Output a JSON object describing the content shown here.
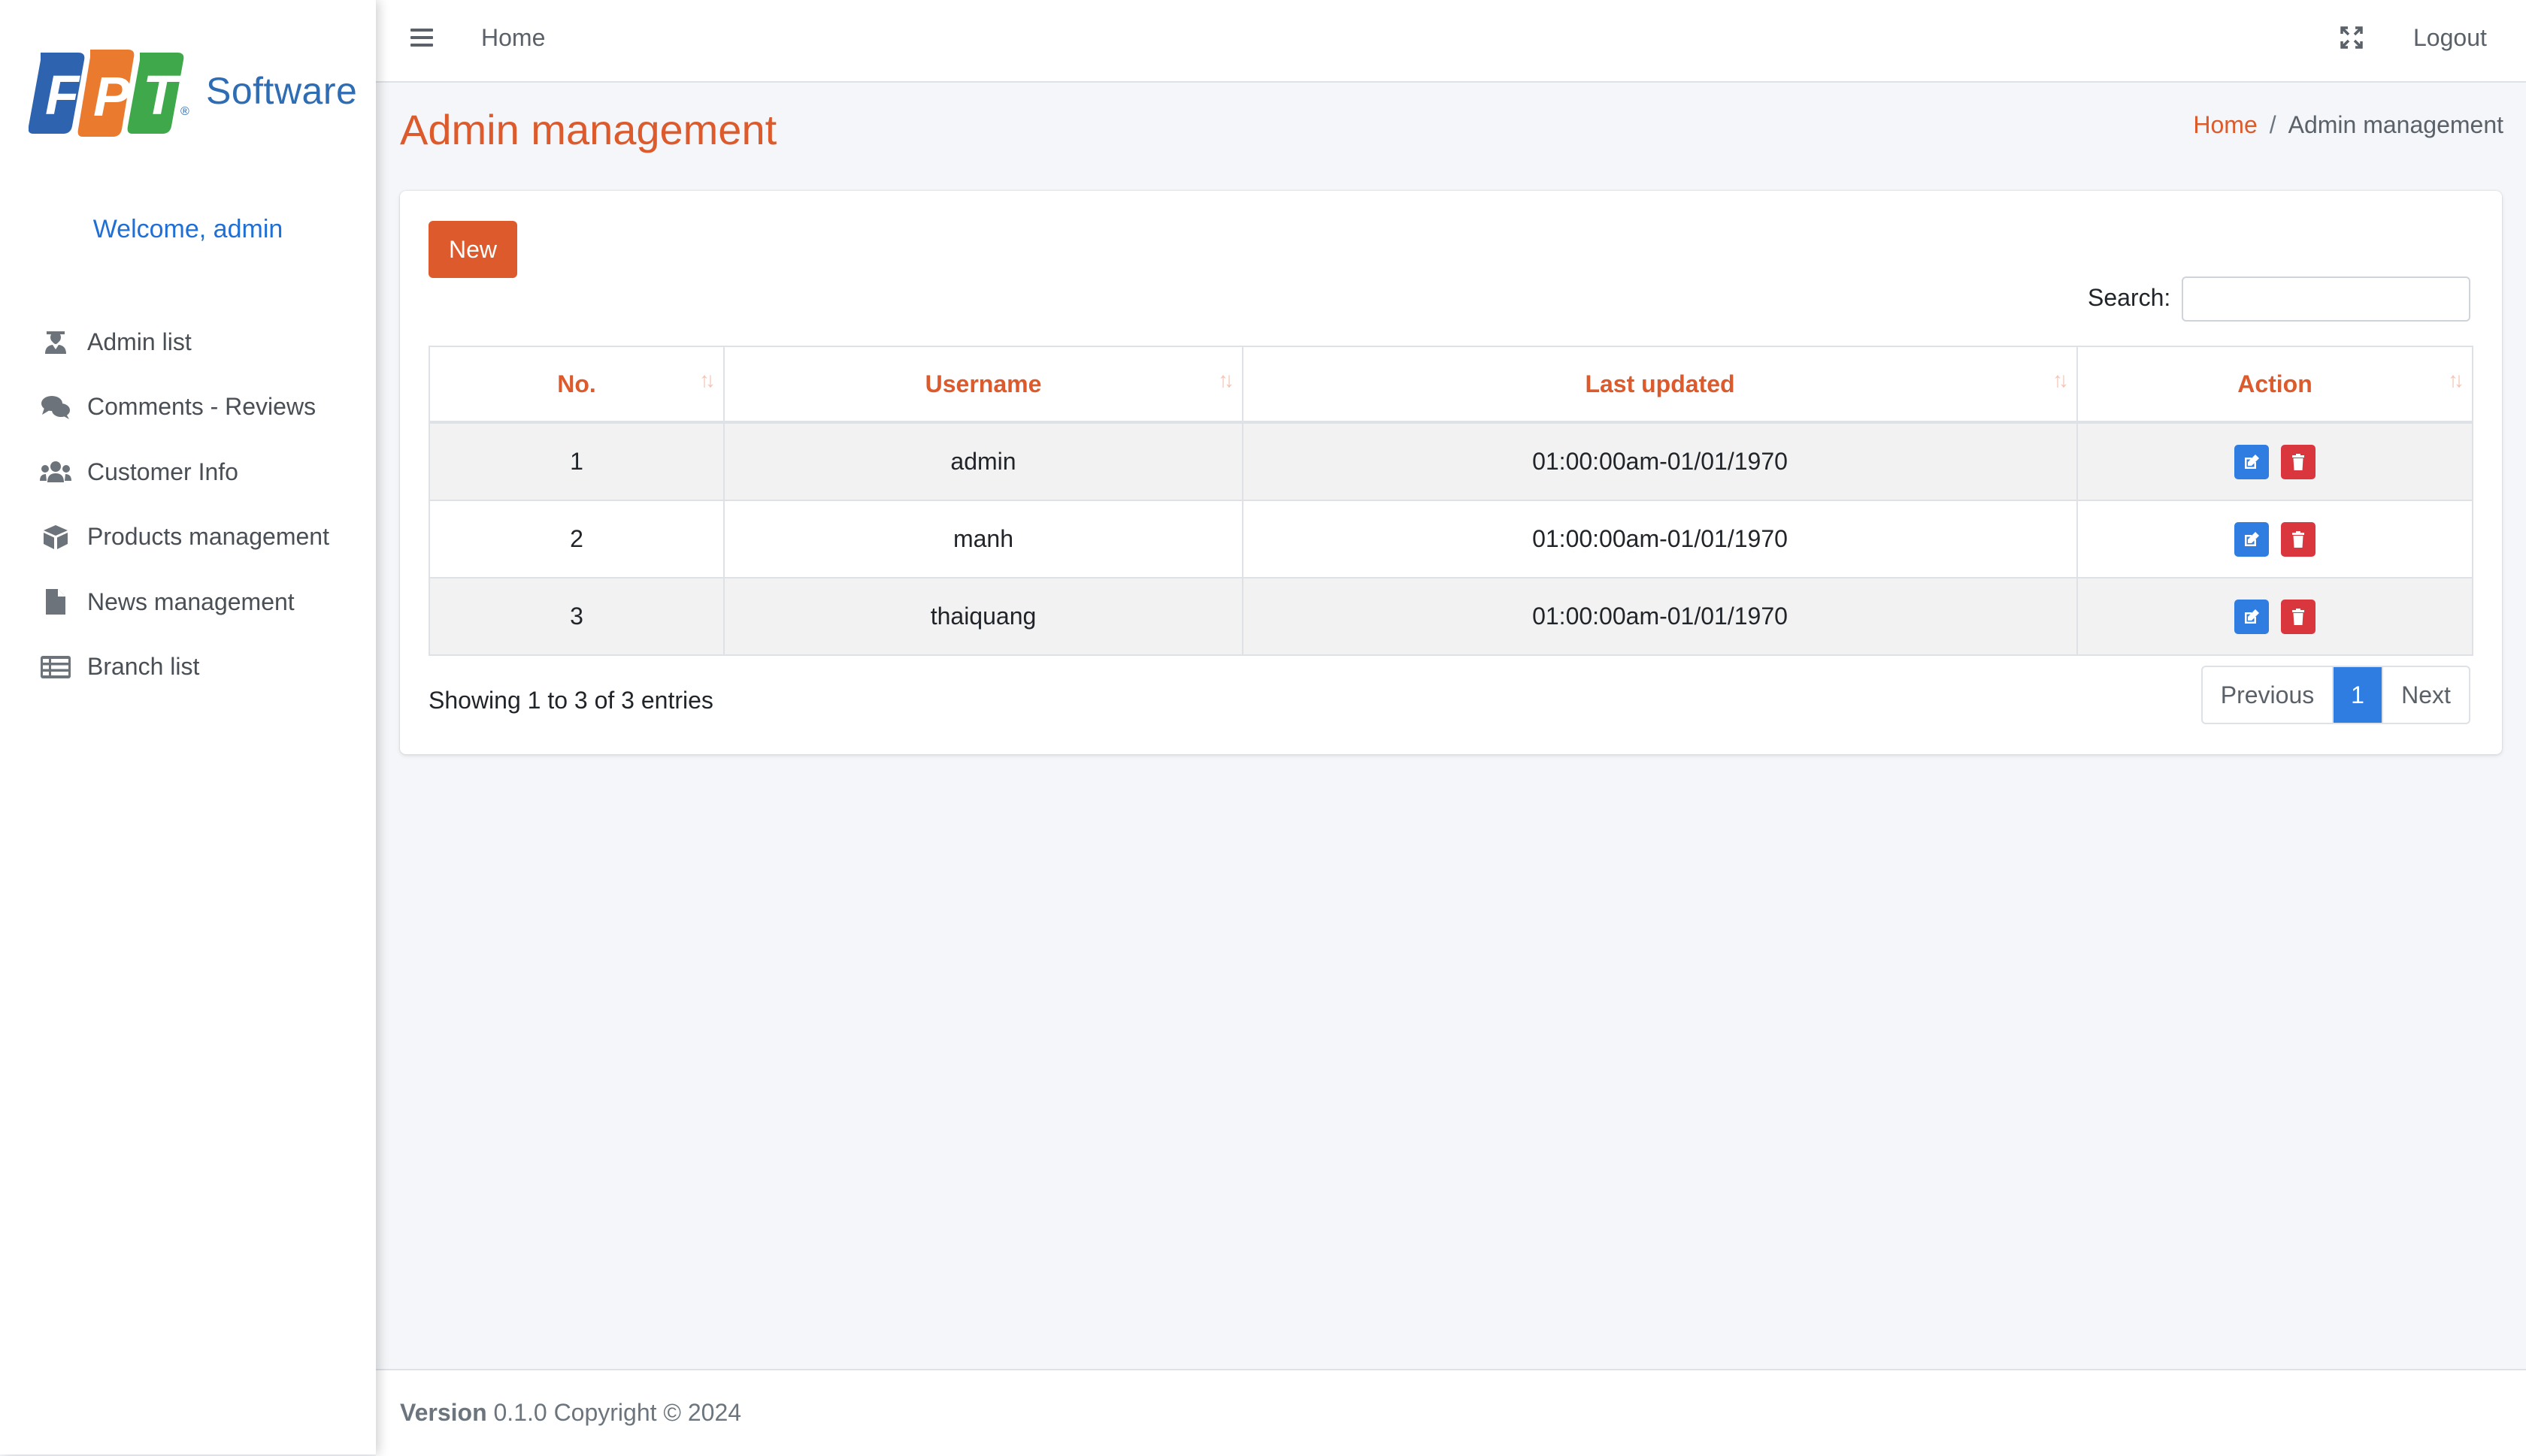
{
  "brand": {
    "logo_letters": [
      "F",
      "P",
      "T"
    ],
    "logo_text": "Software",
    "logo_reg": "®"
  },
  "sidebar": {
    "welcome": "Welcome, admin",
    "items": [
      {
        "label": "Admin list",
        "icon": "user-tie-icon"
      },
      {
        "label": "Comments - Reviews",
        "icon": "comments-icon"
      },
      {
        "label": "Customer Info",
        "icon": "users-icon"
      },
      {
        "label": "Products management",
        "icon": "box-icon"
      },
      {
        "label": "News management",
        "icon": "file-icon"
      },
      {
        "label": "Branch list",
        "icon": "list-icon"
      }
    ]
  },
  "topbar": {
    "home": "Home",
    "logout": "Logout"
  },
  "page": {
    "title": "Admin management"
  },
  "breadcrumb": {
    "home": "Home",
    "separator": "/",
    "current": "Admin management"
  },
  "toolbar": {
    "new_label": "New",
    "search_label": "Search:",
    "search_value": ""
  },
  "table": {
    "columns": [
      "No.",
      "Username",
      "Last updated",
      "Action"
    ],
    "rows": [
      {
        "no": "1",
        "username": "admin",
        "last_updated": "01:00:00am-01/01/1970"
      },
      {
        "no": "2",
        "username": "manh",
        "last_updated": "01:00:00am-01/01/1970"
      },
      {
        "no": "3",
        "username": "thaiquang",
        "last_updated": "01:00:00am-01/01/1970"
      }
    ]
  },
  "pagination": {
    "info": "Showing 1 to 3 of 3 entries",
    "previous": "Previous",
    "current": "1",
    "next": "Next"
  },
  "footer": {
    "version_label": "Version",
    "version_rest": "0.1.0 Copyright © 2024"
  },
  "colors": {
    "accent": "#dc5a2b",
    "primary": "#2f7de1",
    "danger": "#d9363e",
    "link": "#1f6fd6"
  }
}
